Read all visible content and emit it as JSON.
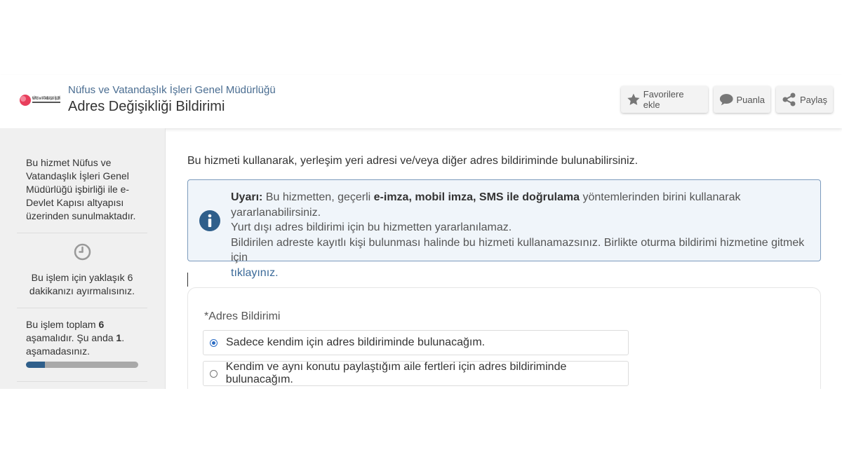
{
  "header": {
    "agency": "Nüfus ve Vatandaşlık İşleri Genel Müdürlüğü",
    "title": "Adres Değişikliği Bildirimi",
    "logo_text": "NÜFUS ve VATANDAŞLIK İŞLERİ",
    "buttons": {
      "favorite": "Favorilere ekle",
      "rate": "Puanla",
      "share": "Paylaş"
    }
  },
  "sidebar": {
    "info": "Bu hizmet Nüfus ve Vatandaşlık İşleri Genel Müdürlüğü işbirliği ile e-Devlet Kapısı altyapısı üzerinden sunulmaktadır.",
    "duration_text": "Bu işlem için yaklaşık 6 dakikanızı ayırmalısınız.",
    "steps_prefix": "Bu işlem toplam ",
    "steps_total": "6",
    "steps_middle": " aşamalıdır. Şu anda ",
    "steps_current": "1",
    "steps_suffix": ". aşamadasınız.",
    "progress_fraction": 0.1667
  },
  "main": {
    "intro": "Bu hizmeti kullanarak, yerleşim yeri adresi ve/veya diğer adres bildiriminde bulunabilirsiniz.",
    "alert": {
      "label": "Uyarı:",
      "part1": " Bu hizmetten, geçerli ",
      "bold": "e-imza, mobil imza, SMS ile doğrulama",
      "part2": " yöntemlerinden birini kullanarak yararlanabilirsiniz.",
      "line2": "Yurt dışı adres bildirimi için bu hizmetten yararlanılamaz.",
      "line3": "Bildirilen adreste kayıtlı kişi bulunması halinde bu hizmeti kullanamazsınız. Birlikte oturma bildirimi hizmetine gitmek için",
      "link": "tıklayınız."
    },
    "form": {
      "label": "*Adres Bildirimi",
      "options": [
        "Sadece kendim için adres bildiriminde bulunacağım.",
        "Kendim ve aynı konutu paylaştığım aile fertleri için adres bildiriminde bulunacağım."
      ],
      "selected_index": 0
    }
  },
  "colors": {
    "accent": "#2f5f8b",
    "link": "#3b6a99",
    "alert_bg": "#f0f5fa",
    "alert_border": "#7c9bbd",
    "logo_red": "#e83e5c"
  }
}
